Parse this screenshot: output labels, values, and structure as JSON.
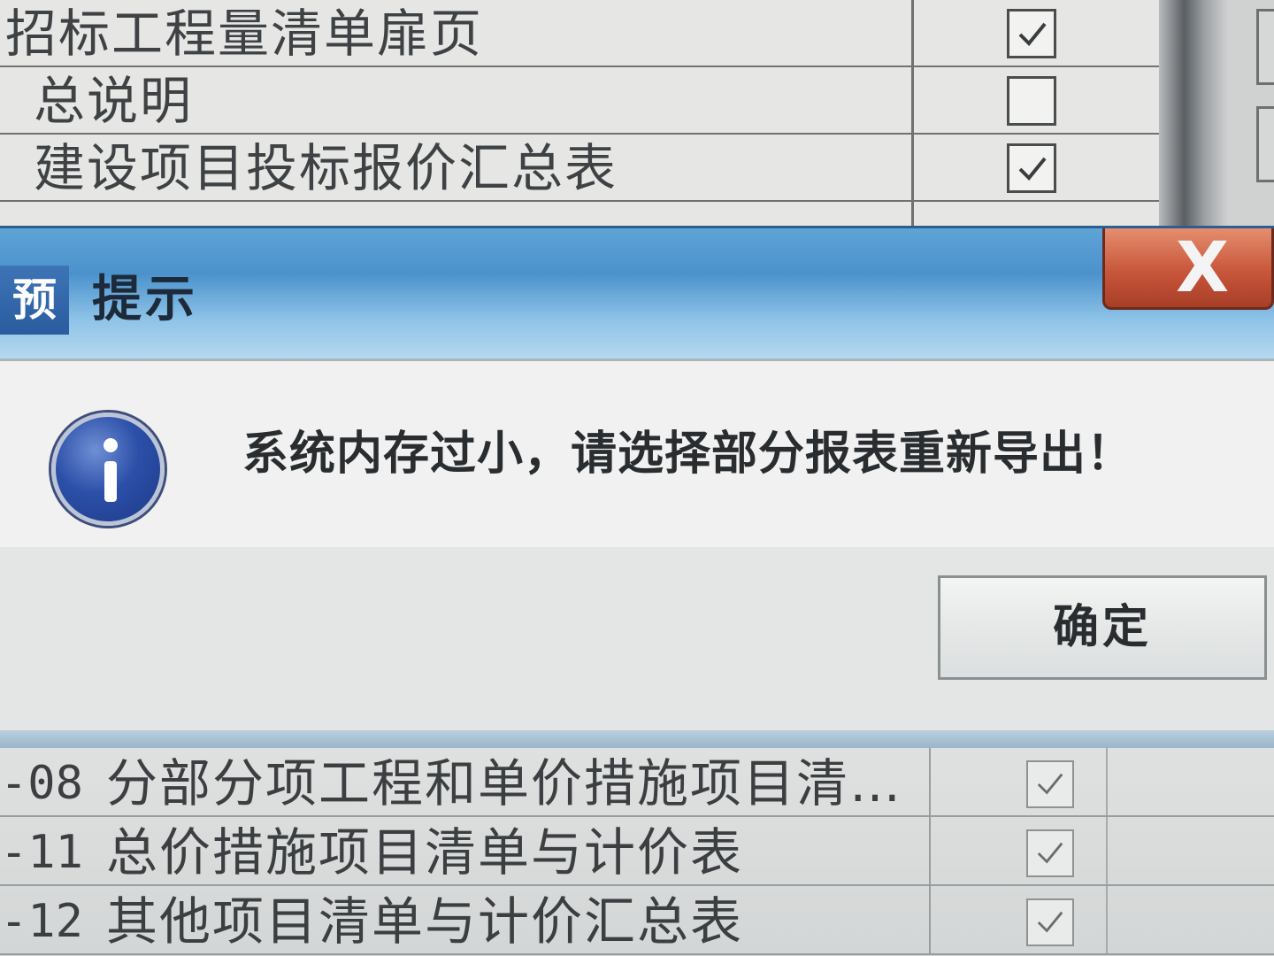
{
  "top_table": {
    "rows": [
      {
        "name": "招标工程量清单扉页",
        "checked": true
      },
      {
        "name": "总说明",
        "checked": false
      },
      {
        "name": "建设项目投标报价汇总表",
        "checked": true
      }
    ]
  },
  "dialog": {
    "app_icon_char": "预",
    "title": "提示",
    "close_label": "X",
    "icon": "info-icon",
    "message": "系统内存过小，请选择部分报表重新导出！",
    "ok_label": "确定"
  },
  "bottom_table": {
    "rows": [
      {
        "code": "-08",
        "name": "分部分项工程和单价措施项目清…",
        "checked": true
      },
      {
        "code": "-11",
        "name": "总价措施项目清单与计价表",
        "checked": true
      },
      {
        "code": "-12",
        "name": "其他项目清单与计价汇总表",
        "checked": true
      }
    ]
  },
  "colors": {
    "titlebar": "#4b92cc",
    "close_button": "#c8563a",
    "info_icon": "#2c4fa8"
  }
}
